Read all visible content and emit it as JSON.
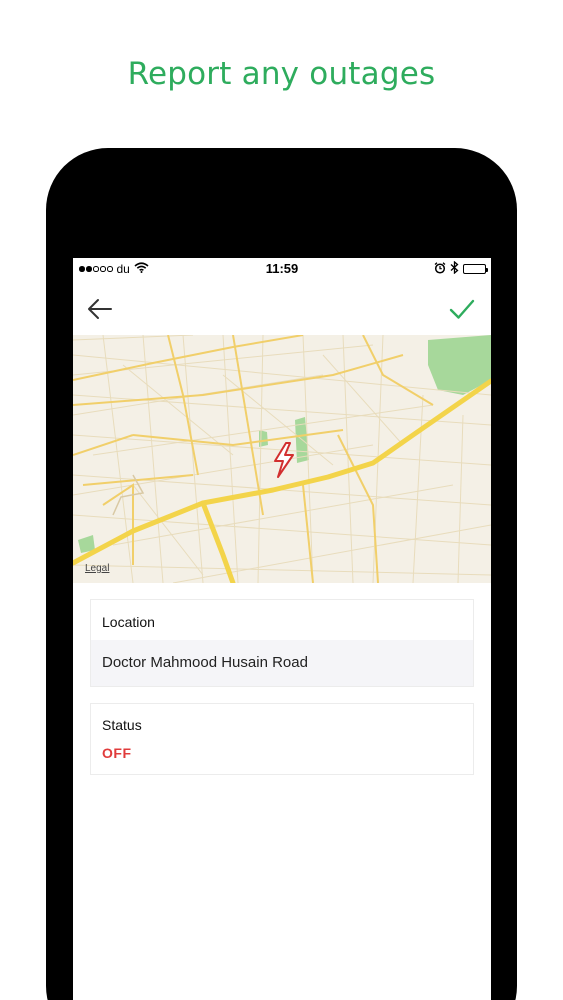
{
  "headline": "Report any outages",
  "status_bar": {
    "carrier": "du",
    "time": "11:59"
  },
  "map": {
    "legal_label": "Legal",
    "marker_icon": "lightning-bolt-icon",
    "marker_color": "#d22f2f"
  },
  "form": {
    "location": {
      "label": "Location",
      "value": "Doctor Mahmood Husain Road"
    },
    "status": {
      "label": "Status",
      "value": "OFF",
      "value_color": "#e03b3b"
    }
  },
  "colors": {
    "accent": "#2eac5d",
    "road": "#f3d44a",
    "park": "#8fce8a",
    "map_background": "#f4f0e6"
  }
}
